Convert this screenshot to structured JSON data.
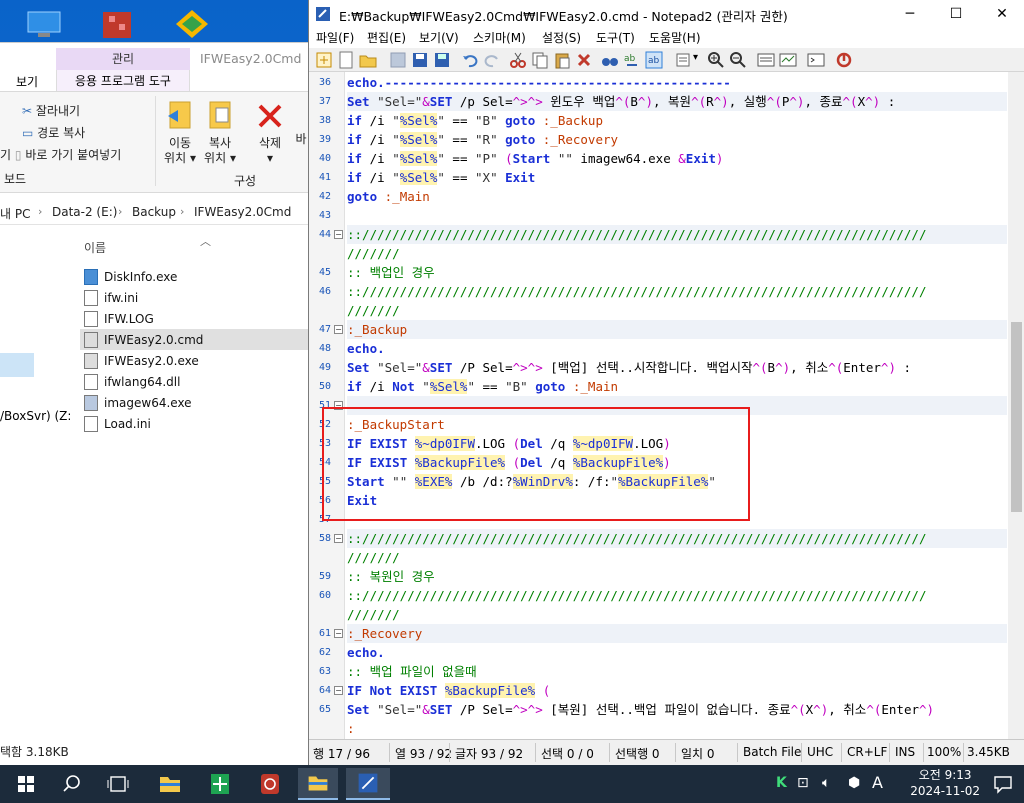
{
  "explorer": {
    "context_tab": "관리",
    "window_title": "IFWEasy2.0Cmd",
    "tab_view": "보기",
    "tab_app_tools": "응용 프로그램 도구",
    "ribbon": {
      "cut": "잘라내기",
      "copy_path": "경로 복사",
      "paste_shortcut": "바로 가기 붙여넣기",
      "clipboard_partial_left": "기",
      "clipboard_group": "보드",
      "move_to_1": "이동",
      "move_to_2": "위치",
      "copy_to_1": "복사",
      "copy_to_2": "위치",
      "delete": "삭제",
      "rename_partial": "바",
      "organize_group": "구성"
    },
    "address": {
      "this_pc": "내 PC",
      "drive": "Data-2 (E:)",
      "folder1": "Backup",
      "folder2": "IFWEasy2.0Cmd"
    },
    "nav_item": "/BoxSvr) (Z:",
    "column_name": "이름",
    "files": [
      {
        "name": "DiskInfo.exe",
        "icon": "app-icon"
      },
      {
        "name": "ifw.ini",
        "icon": "ini-icon"
      },
      {
        "name": "IFW.LOG",
        "icon": "text-icon"
      },
      {
        "name": "IFWEasy2.0.cmd",
        "icon": "cmd-icon"
      },
      {
        "name": "IFWEasy2.0.exe",
        "icon": "app-icon"
      },
      {
        "name": "ifwlang64.dll",
        "icon": "dll-icon"
      },
      {
        "name": "imagew64.exe",
        "icon": "app-icon"
      },
      {
        "name": "Load.ini",
        "icon": "ini-icon"
      }
    ],
    "status": "택함 3.18KB"
  },
  "notepad": {
    "title": "E:₩Backup₩IFWEasy2.0Cmd₩IFWEasy2.0.cmd - Notepad2 (관리자 권한)",
    "menu": [
      "파일(F)",
      "편집(E)",
      "보기(V)",
      "스키마(M)",
      "설정(S)",
      "도구(T)",
      "도움말(H)"
    ],
    "line_numbers": [
      "36",
      "37",
      "38",
      "39",
      "40",
      "41",
      "42",
      "43",
      "44",
      "",
      "45",
      "46",
      "",
      "47",
      "48",
      "49",
      "50",
      "51",
      "52",
      "53",
      "54",
      "55",
      "56",
      "57",
      "58",
      "",
      "59",
      "60",
      "",
      "61",
      "62",
      "63",
      "64",
      "65",
      ""
    ],
    "code": [
      "echo.----------------------------------------------",
      "Set \"Sel=\"&SET /p Sel=^>^> 윈도우 백업^(B^), 복원^(R^), 실행^(P^), 종료^(X^) :",
      "if /i \"%Sel%\" == \"B\" goto :_Backup",
      "if /i \"%Sel%\" == \"R\" goto :_Recovery",
      "if /i \"%Sel%\" == \"P\" (Start \"\" imagew64.exe &Exit)",
      "if /i \"%Sel%\" == \"X\" Exit",
      "goto :_Main",
      "",
      "::///////////////////////////////////////////////////////////////////////////",
      "///////",
      ":: 백업인 경우",
      "::///////////////////////////////////////////////////////////////////////////",
      "///////",
      ":_Backup",
      "echo.",
      "Set \"Sel=\"&SET /P Sel=^>^> [백업] 선택..시작합니다. 백업시작^(B^), 취소^(Enter^) :",
      "if /i Not \"%Sel%\" == \"B\" goto :_Main",
      "",
      ":_BackupStart",
      "IF EXIST %~dp0IFW.LOG (Del /q %~dp0IFW.LOG)",
      "IF EXIST %BackupFile% (Del /q %BackupFile%)",
      "Start \"\" %EXE% /b /d:?%WinDrv%: /f:\"%BackupFile%\"",
      "Exit",
      "",
      "::///////////////////////////////////////////////////////////////////////////",
      "///////",
      ":: 복원인 경우",
      "::///////////////////////////////////////////////////////////////////////////",
      "///////",
      ":_Recovery",
      "echo.",
      ":: 백업 파일이 없을때",
      "IF Not EXIST %BackupFile% (",
      "Set \"Sel=\"&SET /P Sel=^>^> [복원] 선택..백업 파일이 없습니다. 종료^(X^), 취소^(Enter^)",
      ":"
    ],
    "status": {
      "line": "행 17 / 96",
      "col": "열 93 / 92",
      "chars": "글자 93 / 92",
      "sel": "선택 0 / 0",
      "sel_lines": "선택행 0",
      "match": "일치 0",
      "lexer": "Batch File",
      "encoding": "UHC",
      "eol": "CR+LF",
      "ovr": "INS",
      "zoom": "100%",
      "size": "3.45KB"
    }
  },
  "taskbar": {
    "time": "오전 9:13",
    "date": "2024-11-02",
    "ime": "A"
  }
}
